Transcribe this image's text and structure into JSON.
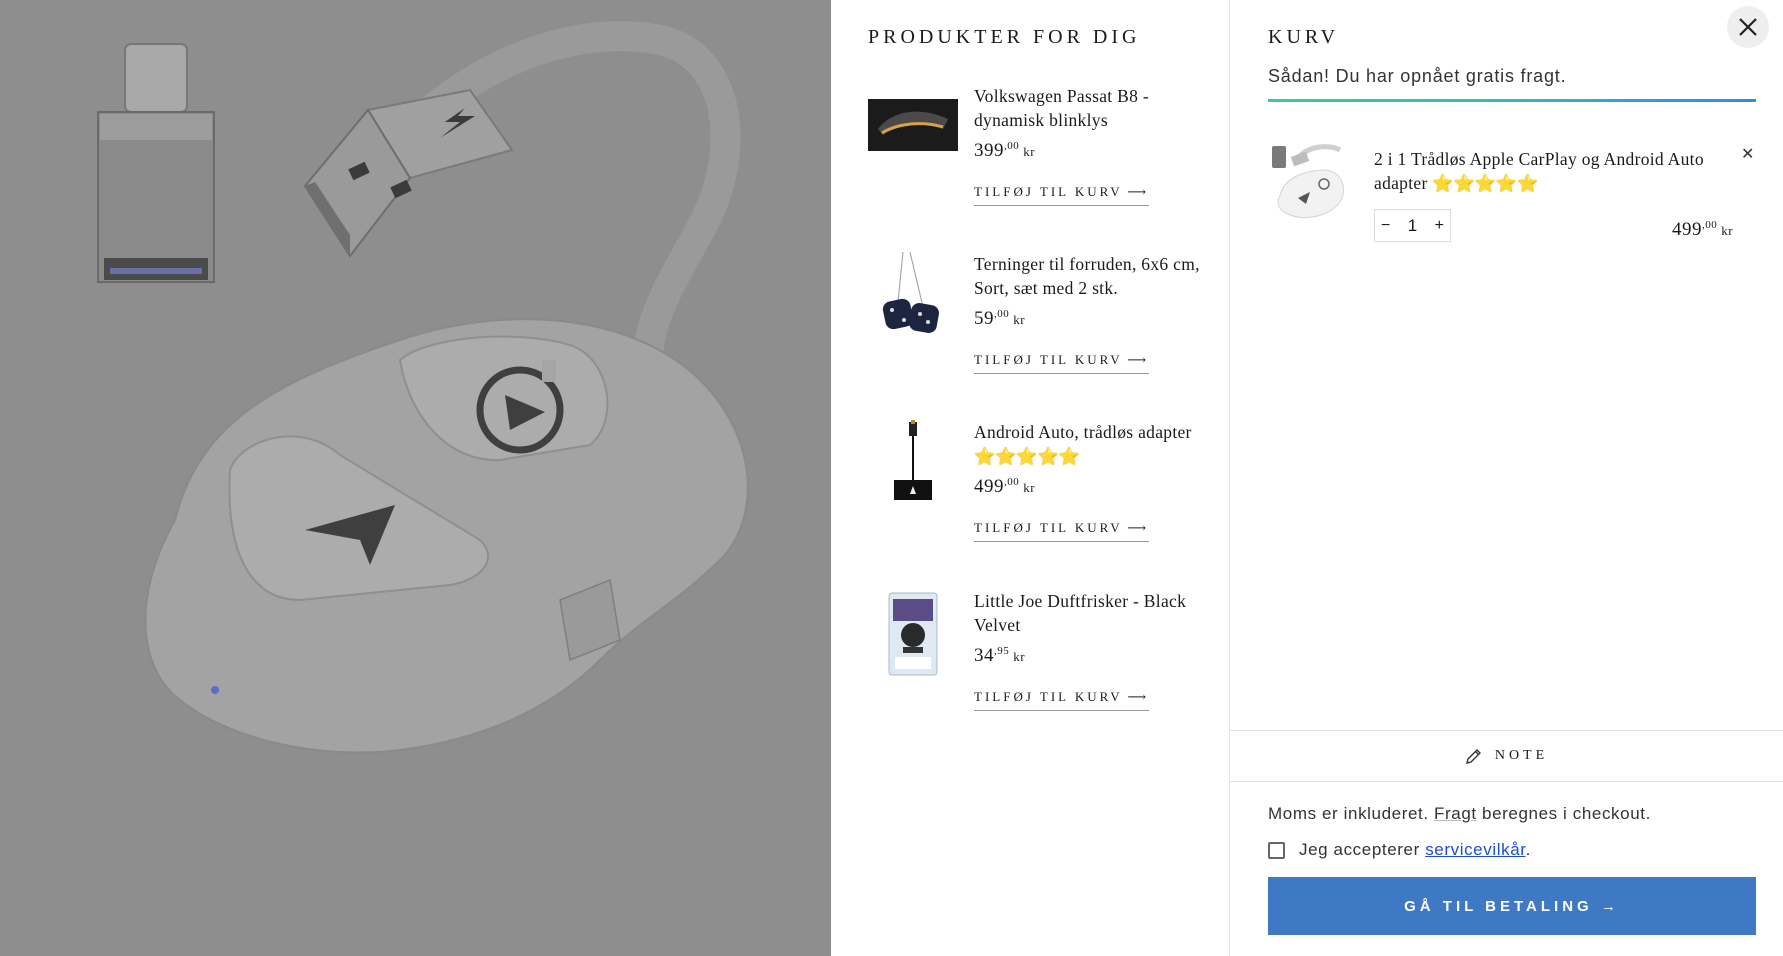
{
  "recommendations": {
    "title": "PRODUKTER FOR DIG",
    "items": [
      {
        "name": "Volkswagen Passat B8 - dynamisk blinklys",
        "price_main": "399",
        "price_cents": ",00",
        "currency": "kr",
        "add_label": "TILFØJ TIL KURV",
        "rating": ""
      },
      {
        "name": "Terninger til forruden, 6x6 cm, Sort, sæt med 2 stk.",
        "price_main": "59",
        "price_cents": ",00",
        "currency": "kr",
        "add_label": "TILFØJ TIL KURV",
        "rating": ""
      },
      {
        "name": "Android Auto, trådløs adapter",
        "price_main": "499",
        "price_cents": ",00",
        "currency": "kr",
        "add_label": "TILFØJ TIL KURV",
        "rating": "⭐⭐⭐⭐⭐"
      },
      {
        "name": "Little Joe Duftfrisker - Black Velvet",
        "price_main": "34",
        "price_cents": ",95",
        "currency": "kr",
        "add_label": "TILFØJ TIL KURV",
        "rating": ""
      }
    ]
  },
  "cart": {
    "title": "KURV",
    "shipping_message": "Sådan! Du har opnået gratis fragt.",
    "shipping_progress": 1.0,
    "items": [
      {
        "name": "2 i 1 Trådløs Apple CarPlay og Android Auto adapter",
        "rating": "⭐⭐⭐⭐⭐",
        "quantity": "1",
        "price_main": "499",
        "price_cents": ",00",
        "currency": "kr"
      }
    ],
    "note_label": "NOTE",
    "tax_text_1": "Moms er inkluderet.",
    "tax_link": "Fragt",
    "tax_text_2": "beregnes i checkout.",
    "terms_text": "Jeg accepterer",
    "terms_link": "servicevilkår",
    "terms_end": ".",
    "checkout_label": "GÅ TIL BETALING →"
  },
  "icons": {
    "close": "close-icon",
    "arrow": "arrow-right-icon",
    "pencil": "pencil-icon",
    "minus": "minus-icon",
    "plus": "plus-icon",
    "remove": "remove-icon"
  },
  "colors": {
    "backdrop": "#8e8e8e",
    "checkout_button": "#3f78c3",
    "link": "#1c4fd1"
  }
}
